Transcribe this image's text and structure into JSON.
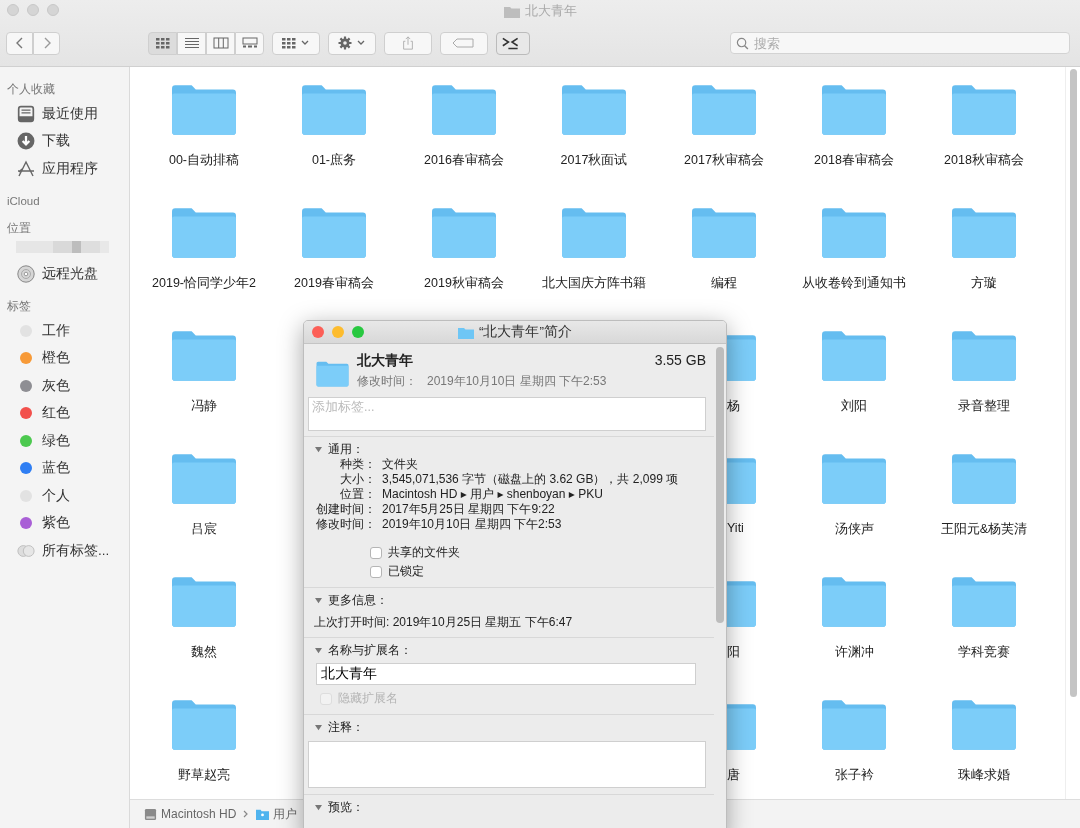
{
  "window": {
    "title": "北大青年"
  },
  "toolbar": {
    "view_modes": [
      {
        "kind": "icons",
        "selected": true
      },
      {
        "kind": "list",
        "selected": false
      },
      {
        "kind": "columns",
        "selected": false
      },
      {
        "kind": "gallery",
        "selected": false
      }
    ],
    "search": {
      "placeholder": "搜索"
    }
  },
  "sidebar": {
    "sections": [
      {
        "heading": "个人收藏",
        "items": [
          {
            "kind": "recents",
            "label": "最近使用"
          },
          {
            "kind": "downloads",
            "label": "下载"
          },
          {
            "kind": "apps",
            "label": "应用程序"
          }
        ]
      },
      {
        "heading": "iCloud"
      },
      {
        "heading": "位置",
        "items": [
          {
            "kind": "redacted"
          },
          {
            "kind": "disc",
            "label": "远程光盘"
          }
        ]
      },
      {
        "heading": "标签",
        "items": [
          {
            "kind": "tag",
            "label": "工作",
            "color": "#e2e2e2"
          },
          {
            "kind": "tag",
            "label": "橙色",
            "color": "#f79a38"
          },
          {
            "kind": "tag",
            "label": "灰色",
            "color": "#8e8e93"
          },
          {
            "kind": "tag",
            "label": "红色",
            "color": "#f2504b"
          },
          {
            "kind": "tag",
            "label": "绿色",
            "color": "#4cc94f"
          },
          {
            "kind": "tag",
            "label": "蓝色",
            "color": "#2f7ef3"
          },
          {
            "kind": "tag",
            "label": "个人",
            "color": "#e2e2e2"
          },
          {
            "kind": "tag",
            "label": "紫色",
            "color": "#a95fd6"
          },
          {
            "kind": "alltags",
            "label": "所有标签..."
          }
        ]
      }
    ]
  },
  "folders": {
    "rows": [
      {
        "items": [
          {
            "name": "00-自动排稿"
          },
          {
            "name": "01-庶务"
          },
          {
            "name": "2016春审稿会"
          },
          {
            "name": "2017秋面试"
          },
          {
            "name": "2017秋审稿会"
          },
          {
            "name": "2018春审稿会"
          },
          {
            "name": "2018秋审稿会"
          }
        ]
      },
      {
        "items": [
          {
            "name": "2019-恰同学少年2"
          },
          {
            "name": "2019春审稿会"
          },
          {
            "name": "2019秋审稿会"
          },
          {
            "name": "北大国庆方阵书籍"
          },
          {
            "name": "编程"
          },
          {
            "name": "从收卷铃到通知书"
          },
          {
            "name": "方璇"
          }
        ]
      },
      {
        "items": [
          {
            "name": "冯静"
          },
          {
            "name": "杨",
            "partial": true
          },
          {
            "name": "刘阳"
          },
          {
            "name": "录音整理"
          }
        ]
      },
      {
        "items": [
          {
            "name": "吕宸"
          },
          {
            "name": "Yiti",
            "partial": true
          },
          {
            "name": "汤侠声"
          },
          {
            "name": "王阳元&杨芙清"
          }
        ]
      },
      {
        "items": [
          {
            "name": "魏然"
          },
          {
            "name": "阳",
            "partial": true
          },
          {
            "name": "许渊冲"
          },
          {
            "name": "学科竞赛"
          }
        ]
      },
      {
        "items": [
          {
            "name": "野草赵亮"
          },
          {
            "name": "唐",
            "partial": true
          },
          {
            "name": "张子衿"
          },
          {
            "name": "珠峰求婚"
          }
        ]
      }
    ]
  },
  "path_bar": [
    {
      "kind": "disk",
      "label": "Macintosh HD"
    },
    {
      "kind": "folder",
      "label": "用户"
    }
  ],
  "info_window": {
    "title": "“北大青年”简介",
    "name": "北大青年",
    "size": "3.55 GB",
    "modified_label": "修改时间：",
    "modified": "2019年10月10日 星期四 下午2:53",
    "tags_placeholder": "添加标签...",
    "general": {
      "heading": "通用：",
      "expanded": true,
      "rows": [
        {
          "label": "种类：",
          "value": "文件夹"
        },
        {
          "label": "大小：",
          "value": "3,545,071,536 字节（磁盘上的 3.62 GB），共 2,099 项"
        },
        {
          "label": "位置：",
          "value": "Macintosh HD ▸ 用户 ▸ shenboyan ▸ PKU"
        },
        {
          "label": "创建时间：",
          "value": "2017年5月25日 星期四 下午9:22"
        },
        {
          "label": "修改时间：",
          "value": "2019年10月10日 星期四 下午2:53"
        }
      ],
      "checkboxes": [
        {
          "label": "共享的文件夹",
          "checked": false
        },
        {
          "label": "已锁定",
          "checked": false
        }
      ]
    },
    "more_info": {
      "heading": "更多信息：",
      "expanded": true,
      "text": "上次打开时间: 2019年10月25日 星期五 下午6:47"
    },
    "name_ext": {
      "heading": "名称与扩展名：",
      "expanded": true,
      "value": "北大青年",
      "hide_extension": {
        "label": "隐藏扩展名",
        "checked": false,
        "disabled": true
      }
    },
    "comments": {
      "heading": "注释：",
      "expanded": true
    },
    "preview": {
      "heading": "预览：",
      "expanded": true
    }
  }
}
